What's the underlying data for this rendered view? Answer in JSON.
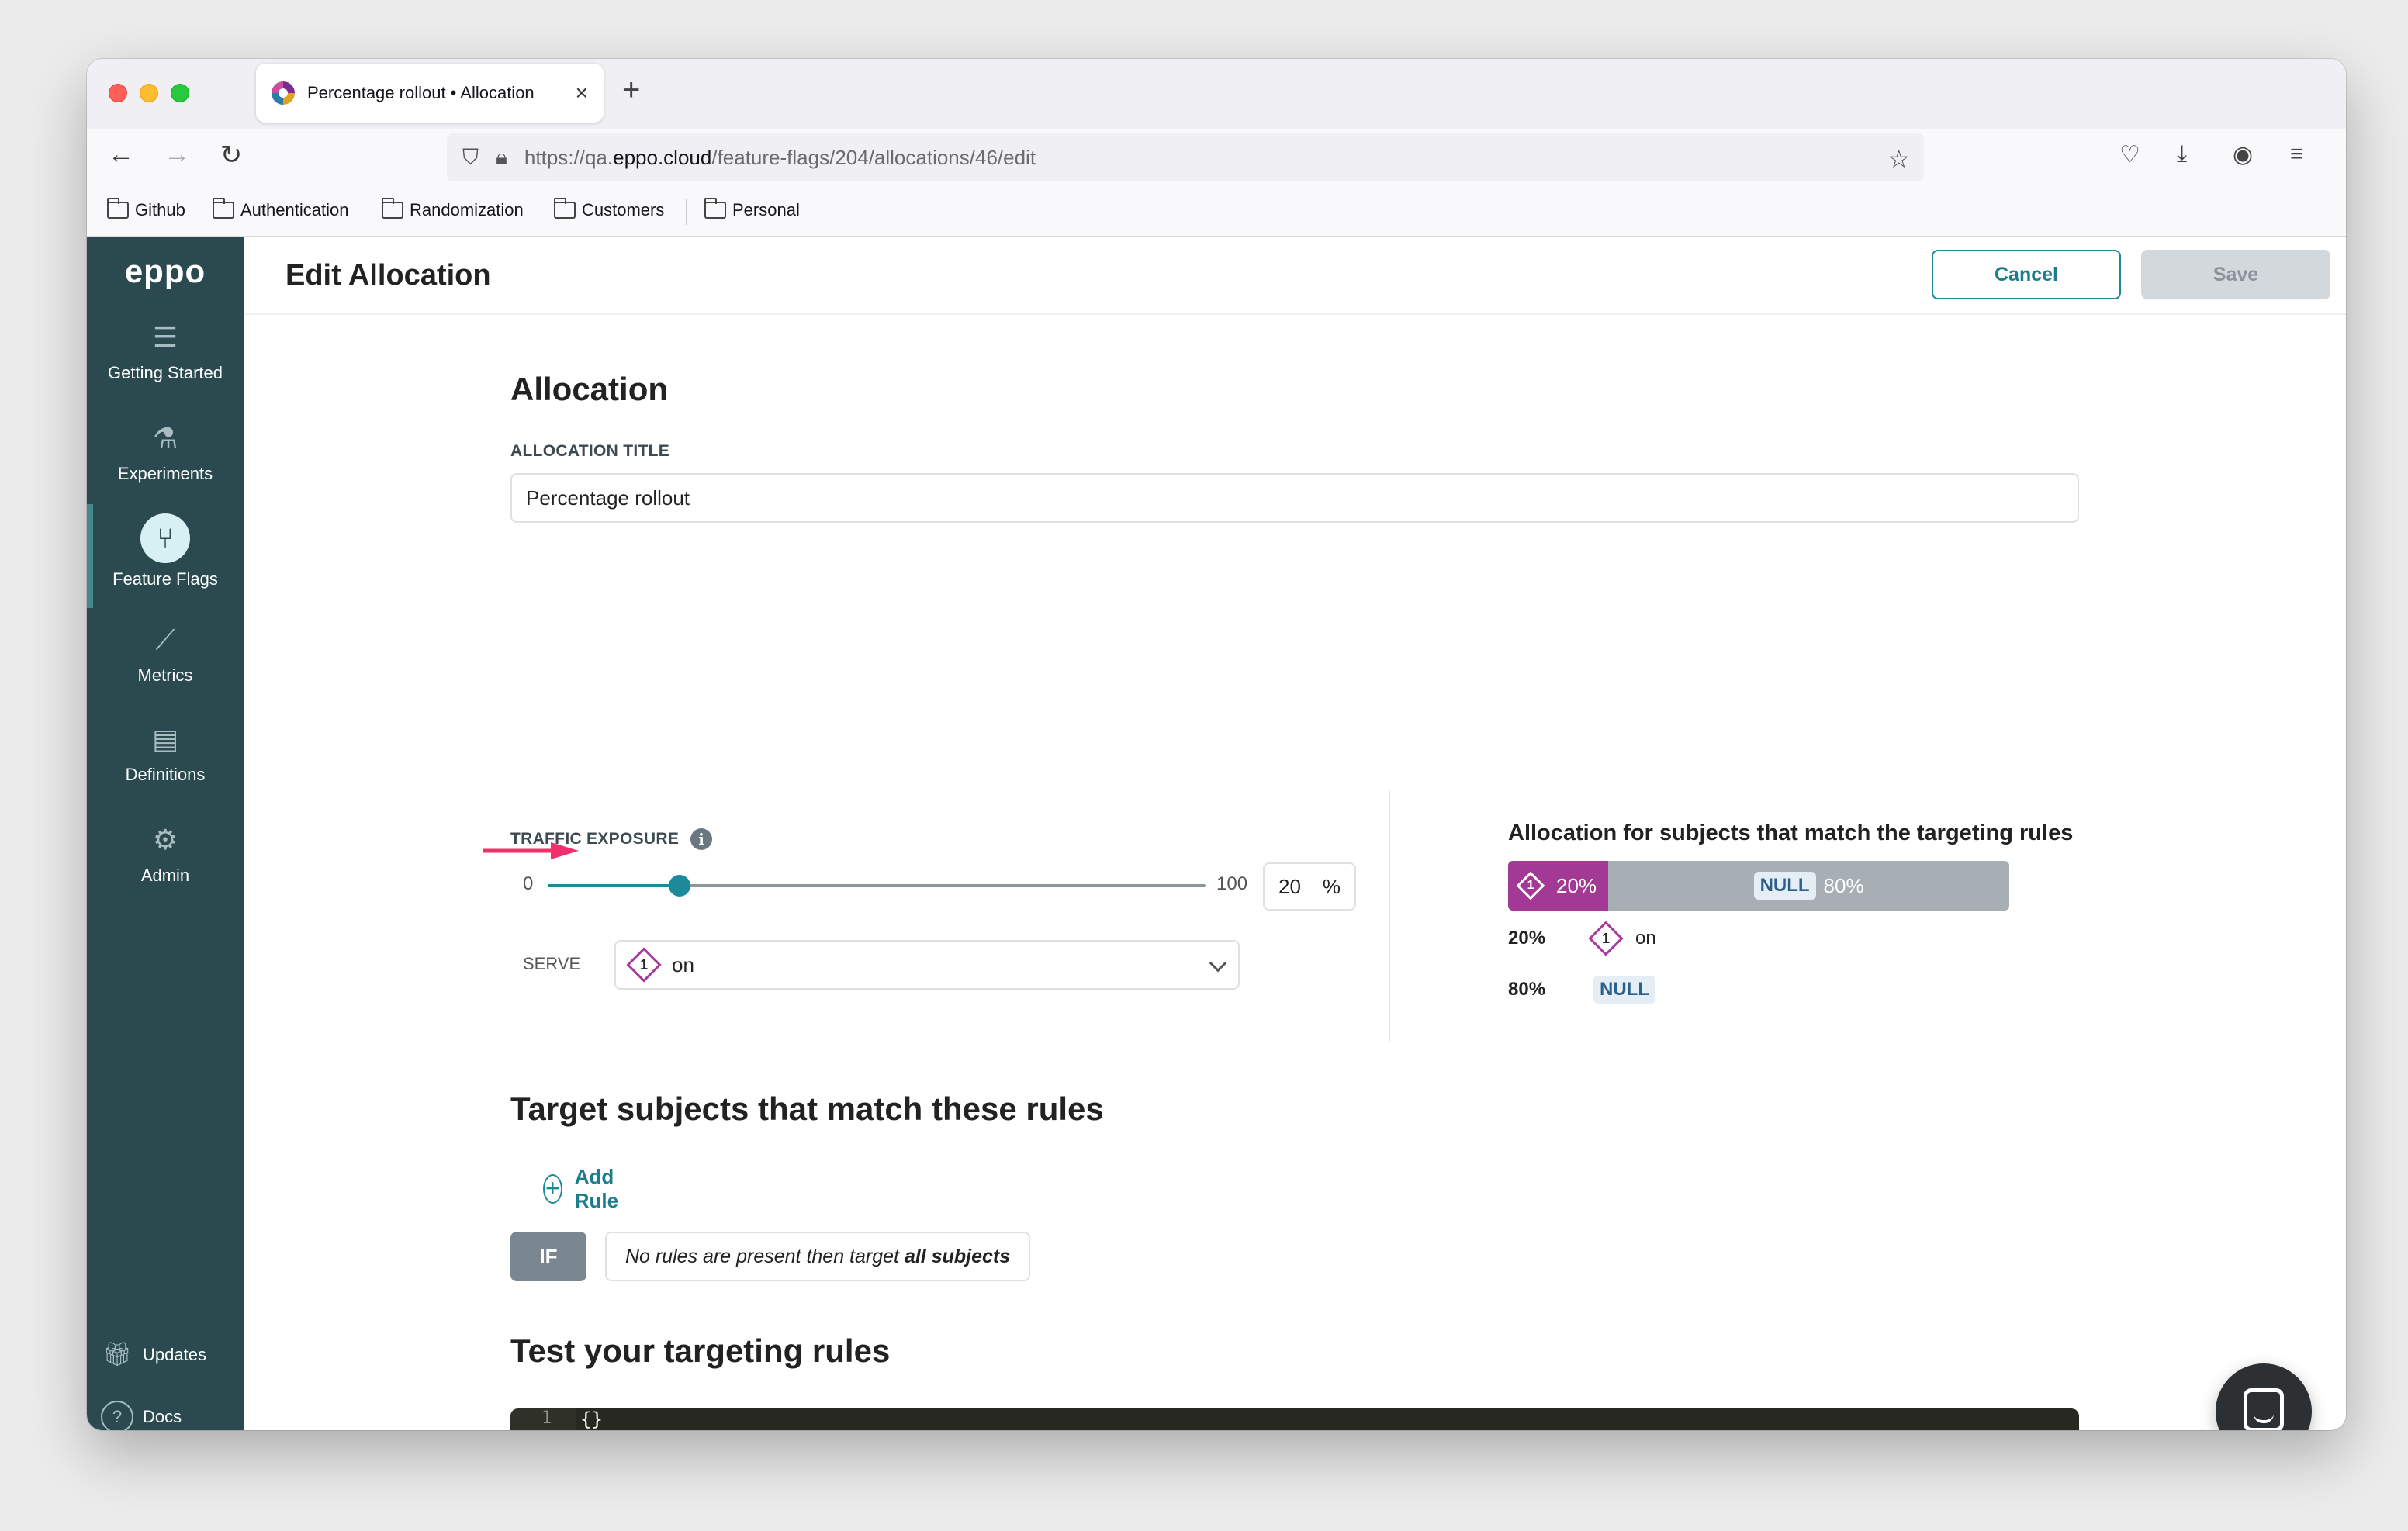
{
  "browser": {
    "tab_title": "Percentage rollout • Allocation",
    "url_scheme": "https://qa.",
    "url_host": "eppo.cloud",
    "url_path": "/feature-flags/204/allocations/46/edit",
    "bookmarks": [
      "Github",
      "Authentication",
      "Randomization",
      "Customers",
      "Personal"
    ]
  },
  "sidebar": {
    "logo": "eppo",
    "items": [
      {
        "label": "Getting Started",
        "icon": "list-icon"
      },
      {
        "label": "Experiments",
        "icon": "flask-icon"
      },
      {
        "label": "Feature Flags",
        "icon": "flag-branch-icon"
      },
      {
        "label": "Metrics",
        "icon": "chart-line-icon"
      },
      {
        "label": "Definitions",
        "icon": "book-icon"
      },
      {
        "label": "Admin",
        "icon": "sliders-icon"
      }
    ],
    "active_item": "Feature Flags",
    "bottom": [
      {
        "label": "Updates",
        "icon": "gift-icon"
      },
      {
        "label": "Docs",
        "icon": "help-icon"
      }
    ]
  },
  "header": {
    "title": "Edit Allocation",
    "cancel_label": "Cancel",
    "save_label": "Save"
  },
  "allocation": {
    "heading": "Allocation",
    "title_label": "ALLOCATION TITLE",
    "title_value": "Percentage rollout",
    "traffic_label": "TRAFFIC EXPOSURE",
    "slider_min": "0",
    "slider_max": "100",
    "traffic_value": "20",
    "traffic_unit": "%",
    "serve_label": "SERVE",
    "serve_variant_number": "1",
    "serve_value": "on"
  },
  "split": {
    "heading": "Allocation for subjects that match the targeting rules",
    "on_pct": "20%",
    "null_pct": "80%",
    "null_label": "NULL",
    "variant_number": "1",
    "legend": [
      {
        "pct": "20%",
        "value": "on"
      },
      {
        "pct": "80%",
        "value": "NULL"
      }
    ]
  },
  "targeting": {
    "heading": "Target subjects that match these rules",
    "add_rule_label": "Add Rule",
    "if_label": "IF",
    "rule_text_prefix": "No rules are present then target ",
    "rule_text_bold": "all subjects"
  },
  "test": {
    "heading": "Test your targeting rules",
    "line_number": "1",
    "code": "{}"
  },
  "colors": {
    "sidebar_bg": "#2a4a50",
    "accent_teal": "#1c8a99",
    "variant_purple": "#a23a95",
    "null_gray": "#a7aeb4",
    "annotation_arrow": "#f0306a"
  }
}
